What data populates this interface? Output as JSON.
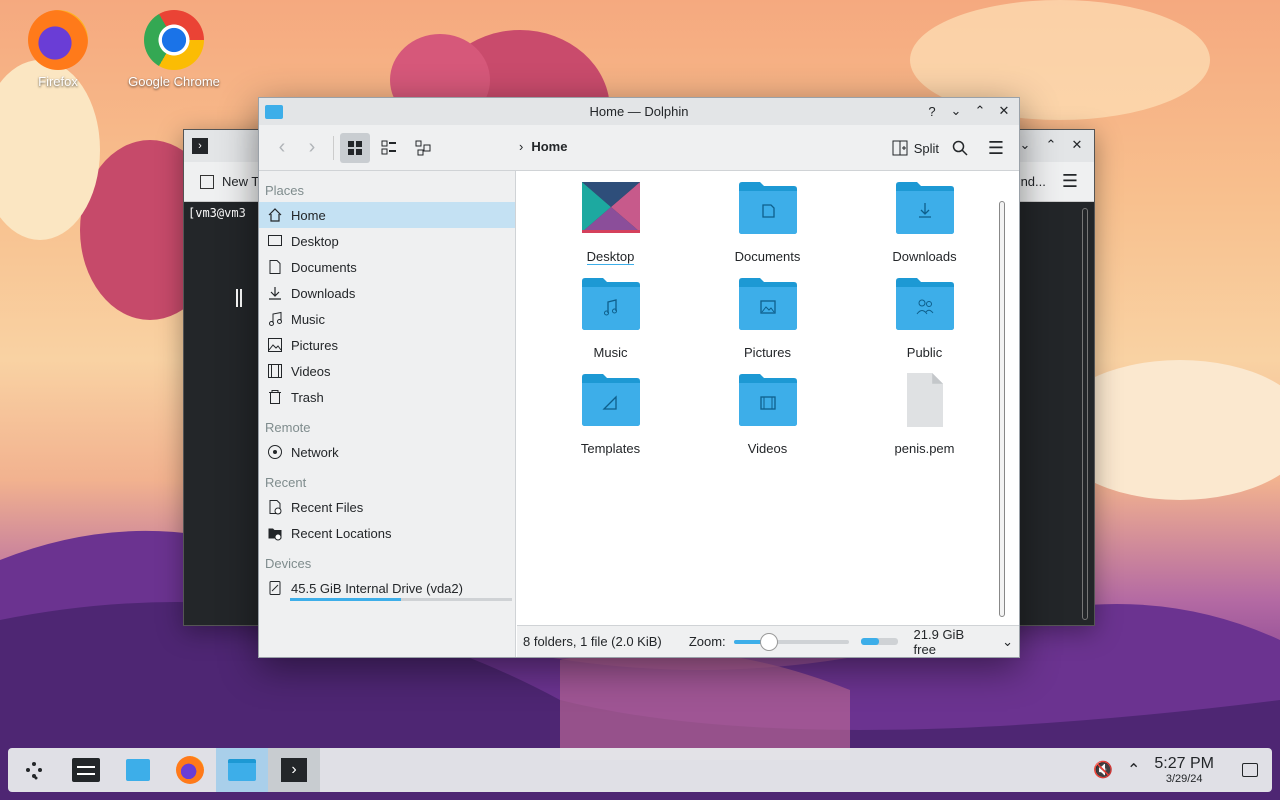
{
  "desktop": {
    "icons": [
      {
        "label": "Firefox",
        "icon": "firefox-icon"
      },
      {
        "label": "Google Chrome",
        "icon": "chrome-icon"
      }
    ]
  },
  "terminal": {
    "toolbar_left": "New T",
    "toolbar_right": "nd...",
    "prompt": "[vm3@vm3"
  },
  "dolphin": {
    "title": "Home — Dolphin",
    "breadcrumb": "Home",
    "split_label": "Split",
    "places": {
      "header": "Places",
      "items": [
        {
          "label": "Home",
          "icon": "home-icon"
        },
        {
          "label": "Desktop",
          "icon": "desktop-icon"
        },
        {
          "label": "Documents",
          "icon": "documents-icon"
        },
        {
          "label": "Downloads",
          "icon": "downloads-icon"
        },
        {
          "label": "Music",
          "icon": "music-icon"
        },
        {
          "label": "Pictures",
          "icon": "pictures-icon"
        },
        {
          "label": "Videos",
          "icon": "videos-icon"
        },
        {
          "label": "Trash",
          "icon": "trash-icon"
        }
      ]
    },
    "remote": {
      "header": "Remote",
      "items": [
        {
          "label": "Network",
          "icon": "network-icon"
        }
      ]
    },
    "recent": {
      "header": "Recent",
      "items": [
        {
          "label": "Recent Files",
          "icon": "recent-files-icon"
        },
        {
          "label": "Recent Locations",
          "icon": "recent-locations-icon"
        }
      ]
    },
    "devices": {
      "header": "Devices",
      "items": [
        {
          "label": "45.5 GiB Internal Drive (vda2)",
          "icon": "drive-icon",
          "usage_fraction": 0.5
        }
      ]
    },
    "files": [
      {
        "label": "Desktop",
        "type": "desktop-folder"
      },
      {
        "label": "Documents",
        "type": "documents-folder"
      },
      {
        "label": "Downloads",
        "type": "downloads-folder"
      },
      {
        "label": "Music",
        "type": "music-folder"
      },
      {
        "label": "Pictures",
        "type": "pictures-folder"
      },
      {
        "label": "Public",
        "type": "public-folder"
      },
      {
        "label": "Templates",
        "type": "templates-folder"
      },
      {
        "label": "Videos",
        "type": "videos-folder"
      },
      {
        "label": "penis.pem",
        "type": "file"
      }
    ],
    "status": {
      "summary": "8 folders, 1 file (2.0 KiB)",
      "zoom_label": "Zoom:",
      "free": "21.9 GiB free",
      "free_fraction": 0.5
    }
  },
  "taskbar": {
    "time": "5:27 PM",
    "date": "3/29/24"
  },
  "colors": {
    "accent": "#3daee9",
    "selection": "#c4e1f3",
    "folder": "#3daee9"
  }
}
